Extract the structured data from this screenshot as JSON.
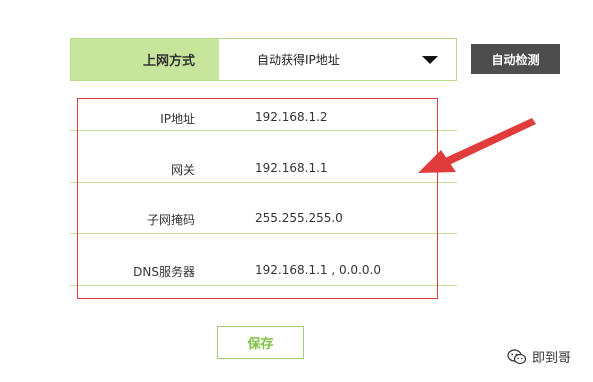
{
  "connection": {
    "label": "上网方式",
    "selected": "自动获得IP地址",
    "detect_button": "自动检测"
  },
  "fields": [
    {
      "label": "IP地址",
      "value": "192.168.1.2"
    },
    {
      "label": "网关",
      "value": "192.168.1.1"
    },
    {
      "label": "子网掩码",
      "value": "255.255.255.0"
    },
    {
      "label": "DNS服务器",
      "value": "192.168.1.1 , 0.0.0.0"
    }
  ],
  "save_button": "保存",
  "watermark": {
    "text": "即到哥",
    "icon": "wechat-icon"
  },
  "colors": {
    "accent_green": "#c8e59c",
    "border_green": "#b6d98c",
    "save_text_green": "#7cc242",
    "detect_button_bg": "#4d4d4d",
    "annotation_red": "#e03c3c"
  }
}
